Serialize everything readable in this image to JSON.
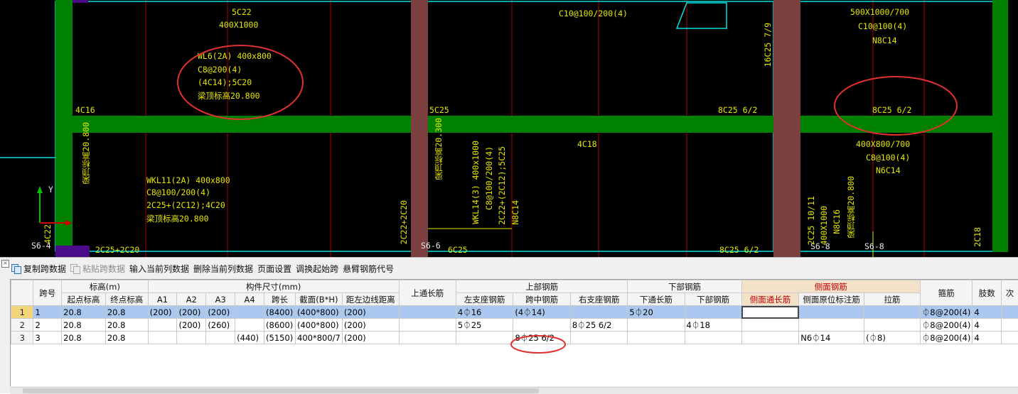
{
  "cad": {
    "texts": {
      "t1": "5C22",
      "t2": "400X1000",
      "t3": "C10@100/200(4)",
      "t4": "500X1000/700",
      "t5": "C10@100(4)",
      "t6": "N8C14",
      "t7": "16C25 7/9",
      "t8": "WL6(2A) 400x800",
      "t9": "C8@200(4)",
      "t10": "(4C14);5C20",
      "t11": "梁顶标高20.800",
      "t12": "4C16",
      "t13": "5C25",
      "t14": "8C25 6/2",
      "t15": "8C25 6/2",
      "t16": "4C18",
      "t17": "400X800/700",
      "t18": "C8@100(4)",
      "t19": "N6C14",
      "t20": "梁顶标高20.800",
      "t21": "梁顶标高20.300",
      "t22": "WKL11(2A) 400x800",
      "t23": "C8@100/200(4)",
      "t24": "2C25+(2C12);4C20",
      "t25": "梁顶标高20.800",
      "t26": "WKL14(3) 400x1000",
      "t27": "C8@100/200(4)",
      "t28": "2C22+(2C12);5C25",
      "t29": "N8C14",
      "t30": "2C22+2C20",
      "t31": "2C25+2C20",
      "t32": "6C25",
      "t33": "8C25 6/2",
      "t34": "S6-4",
      "t35": "S6-6",
      "t36": "S6-8",
      "t37": "S6-8",
      "t38": "4C22",
      "t39": "2C18",
      "t40": "2C25 10/11",
      "t41": "400X1000",
      "t42": "N8C16",
      "t43": "梁顶标高20.800",
      "t44": "Y"
    },
    "colors": {
      "beam": "#008000",
      "column": "#7b3f3f",
      "grid": "#00e0e0",
      "axis": "#cc0000",
      "text": "#e6e600",
      "highlight": "#e03030"
    }
  },
  "toolbar": {
    "copy_span": "复制跨数据",
    "paste_span": "粘贴跨数据",
    "input_col": "输入当前列数据",
    "delete_col": "删除当前列数据",
    "page_setup": "页面设置",
    "adjust_start": "调换起始跨",
    "cantilever": "悬臂钢筋代号"
  },
  "grid": {
    "headers": {
      "span_no": "跨号",
      "elevation": "标高(m)",
      "start_elev": "起点标高",
      "end_elev": "终点标高",
      "dims": "构件尺寸(mm)",
      "a1": "A1",
      "a2": "A2",
      "a3": "A3",
      "a4": "A4",
      "span_len": "跨长",
      "section": "截面(B*H)",
      "dist_left": "距左边线距离",
      "top_through": "上通长筋",
      "top_bars": "上部钢筋",
      "left_support": "左支座钢筋",
      "mid_span": "跨中钢筋",
      "right_support": "右支座钢筋",
      "bottom_bars": "下部钢筋",
      "bottom_through": "下通长筋",
      "bottom_bar": "下部钢筋",
      "side_bars": "侧面钢筋",
      "side_through": "侧面通长筋",
      "side_marked": "侧面原位标注筋",
      "tie": "拉筋",
      "stirrup": "箍筋",
      "legs": "肢数",
      "next": "次"
    },
    "rows": [
      {
        "rn": "1",
        "span": "1",
        "start": "20.8",
        "end": "20.8",
        "a1": "(200)",
        "a2": "(200)",
        "a3": "(200)",
        "a4": "",
        "len": "(8400)",
        "sec": "(400*800)",
        "dist": "(200)",
        "top_thr": "",
        "left": "4⏀16",
        "mid": "(4⏀14)",
        "right": "",
        "bot_thr": "5⏀20",
        "bot": "",
        "side_thr": "",
        "side_mark": "",
        "tie": "",
        "stir": "⏀8@200(4)",
        "legs": "4"
      },
      {
        "rn": "2",
        "span": "2",
        "start": "20.8",
        "end": "20.8",
        "a1": "",
        "a2": "(200)",
        "a3": "(260)",
        "a4": "",
        "len": "(8600)",
        "sec": "(400*800)",
        "dist": "(200)",
        "top_thr": "",
        "left": "5⏀25",
        "mid": "",
        "right": "8⏀25 6/2",
        "bot_thr": "",
        "bot": "4⏀18",
        "side_thr": "",
        "side_mark": "",
        "tie": "",
        "stir": "⏀8@200(4)",
        "legs": "4"
      },
      {
        "rn": "3",
        "span": "3",
        "start": "20.8",
        "end": "20.8",
        "a1": "",
        "a2": "",
        "a3": "",
        "a4": "(440)",
        "len": "(5150)",
        "sec": "400*800/7",
        "dist": "(200)",
        "top_thr": "",
        "left": "",
        "mid": "8⏀25 6/2",
        "right": "",
        "bot_thr": "",
        "bot": "",
        "side_thr": "",
        "side_mark": "N6⏀14",
        "tie": "(⏀8)",
        "stir": "⏀8@200(4)",
        "legs": "4"
      }
    ]
  }
}
